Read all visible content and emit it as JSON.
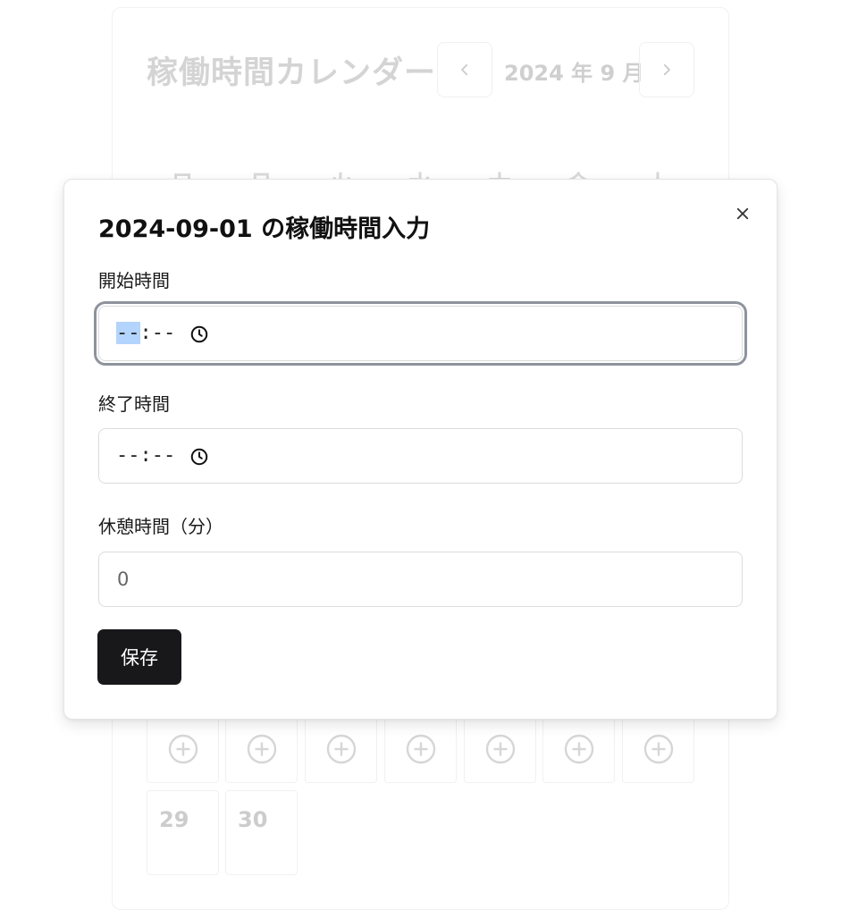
{
  "calendar": {
    "title": "稼働時間カレンダー",
    "month_label": "2024 年 9 月",
    "prev_icon": "chevron-left-icon",
    "next_icon": "chevron-right-icon",
    "weekdays": [
      "日",
      "月",
      "火",
      "水",
      "木",
      "金",
      "土"
    ],
    "visible_days": [
      "29",
      "30"
    ],
    "add_icon": "plus-circle-icon"
  },
  "modal": {
    "title": "2024-09-01 の稼働時間入力",
    "close_icon": "close-icon",
    "start": {
      "label": "開始時間",
      "hours_placeholder": "--",
      "separator": ":",
      "minutes_placeholder": "--",
      "icon": "clock-icon"
    },
    "end": {
      "label": "終了時間",
      "hours_placeholder": "--",
      "separator": ":",
      "minutes_placeholder": "--",
      "icon": "clock-icon"
    },
    "break": {
      "label": "休憩時間（分）",
      "value": "0"
    },
    "save_label": "保存"
  },
  "colors": {
    "primary_button": "#18181b",
    "focus_ring": "#8e939c",
    "selection_highlight": "#b3d4fc"
  }
}
